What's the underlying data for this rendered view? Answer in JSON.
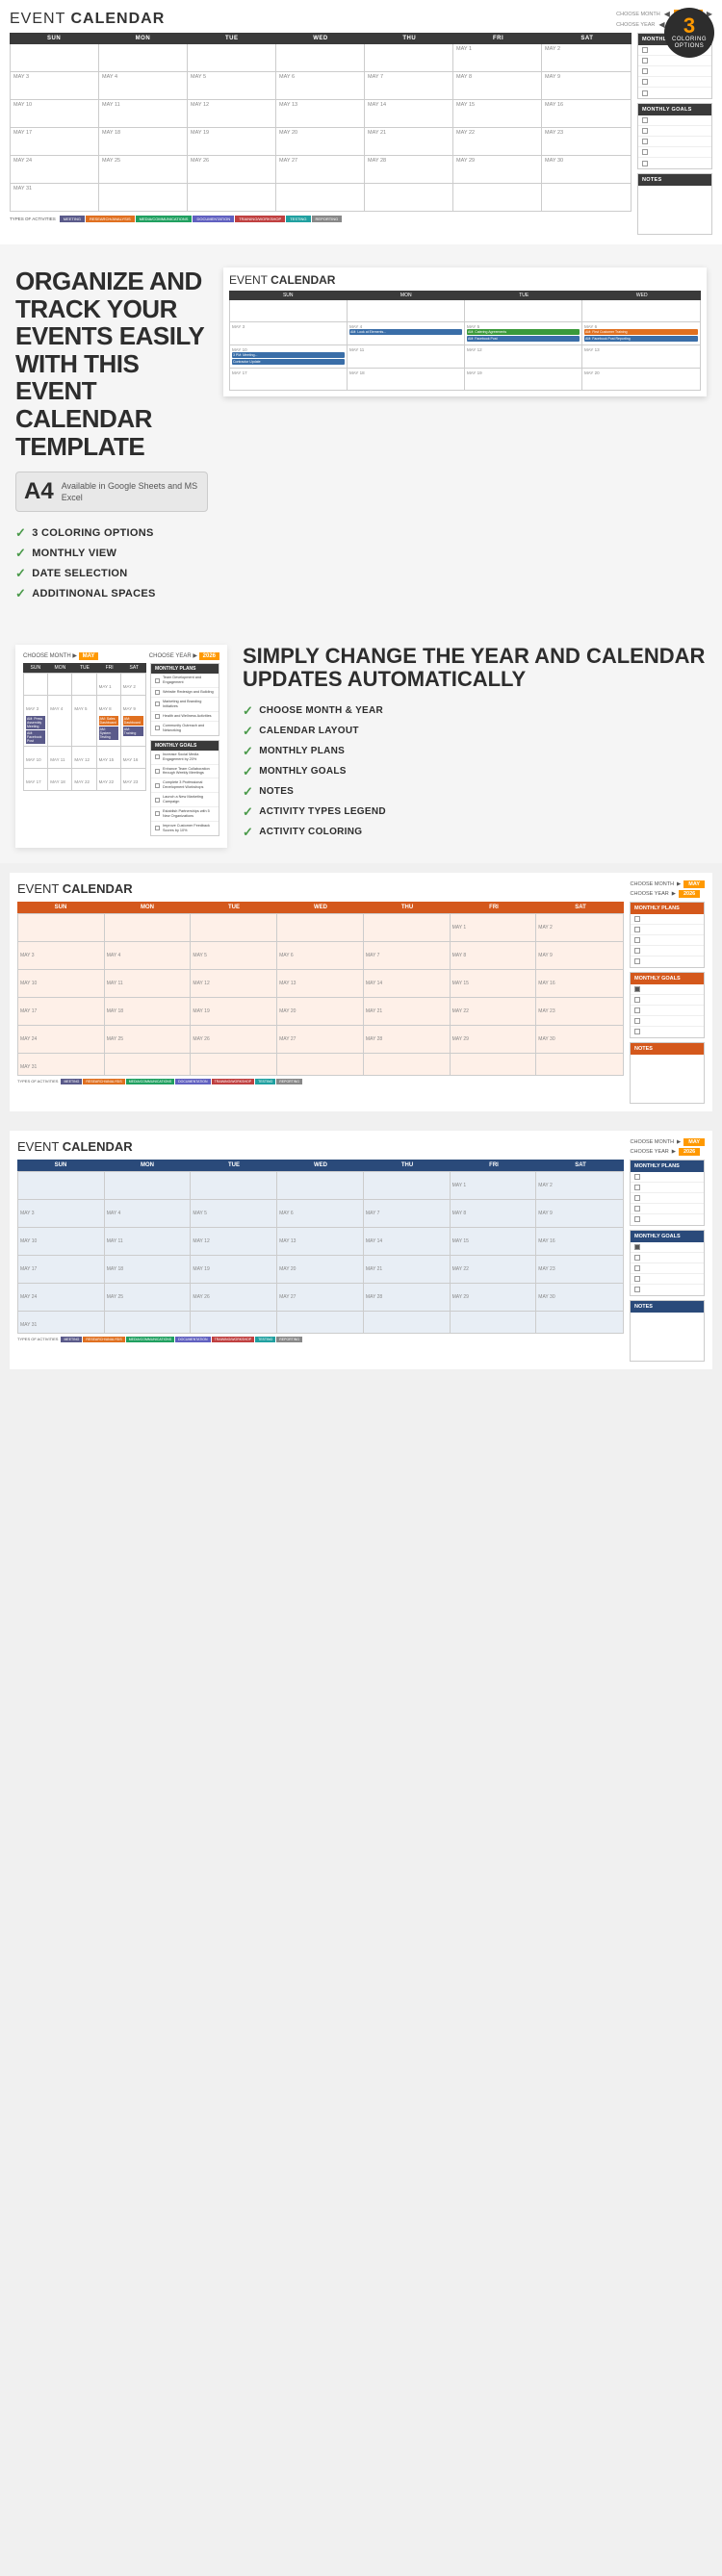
{
  "badge": {
    "number": "3",
    "line1": "COLORING",
    "line2": "OPTIONS"
  },
  "calendar1": {
    "title": "EVENT",
    "title_bold": "CALENDAR",
    "choose_month_label": "CHOOSE MONTH",
    "choose_year_label": "CHOOSE YEAR",
    "month_val": "MAY",
    "year_val": "2026",
    "days": [
      "SUN",
      "MON",
      "TUE",
      "WED",
      "THU",
      "FRI",
      "SAT"
    ],
    "sidebar_plans_title": "MONTHLY PLANS",
    "sidebar_goals_title": "MONTHLY GOALS",
    "sidebar_notes_title": "NOTES",
    "activity_types_title": "TYPES OF ACTIVITIES",
    "activity_types": [
      {
        "label": "MEETING",
        "color": "#5a5a8a"
      },
      {
        "label": "RESEARCH/ANALYSIS",
        "color": "#e07020"
      },
      {
        "label": "MEDIA/COMMUNICATIONS",
        "color": "#20a060"
      },
      {
        "label": "DOCUMENTATION",
        "color": "#6060c0"
      },
      {
        "label": "TRAINING/WORKSHOP",
        "color": "#c04040"
      },
      {
        "label": "TESTING",
        "color": "#20a0a0"
      },
      {
        "label": "REPORTING",
        "color": "#888888"
      }
    ]
  },
  "features": {
    "title": "ORGANIZE AND TRACK YOUR EVENTS EASILY WITH THIS EVENT CALENDAR TEMPLATE",
    "a4_letter": "A4",
    "a4_text": "Available in Google Sheets\nand MS Excel",
    "items": [
      "3 COLORING OPTIONS",
      "MONTHLY VIEW",
      "DATE SELECTION",
      "ADDITINONAL SPACES"
    ]
  },
  "plans_section": {
    "title": "SIMPLY CHANGE THE YEAR AND CALENDAR UPDATES AUTOMATICALLY",
    "items": [
      "CHOOSE MONTH & YEAR",
      "CALENDAR LAYOUT",
      "MONTHLY PLANS",
      "MONTHLY GOALS",
      "NOTES",
      "ACTIVITY TYPES LEGEND",
      "ACTIVITY COLORING"
    ],
    "monthly_plans_title": "MONTHLY PLANS",
    "monthly_goals_title": "MONTHLY GOALS",
    "plans_items": [
      "Team Development and Engagement",
      "Website Redesign and Building",
      "Marketing and Branding Initiatives",
      "Health and Wellness Activities",
      "Community Outreach and Networking"
    ],
    "goals_items": [
      "Increase Social Media Engagement by 20%",
      "Enhance Team Collaboration through Weekly Meetings",
      "Complete 3 Professional Development Workshops",
      "Launch a New Marketing Campaign",
      "Establish Partnerships with 5 New Organizations",
      "Improve Customer Feedback Scores by 10%"
    ]
  },
  "cal_labels": {
    "layout_label": "CALENDAR LAYOUT",
    "legend_label": "ACTIVITY TYPES LEGEND"
  },
  "colors": {
    "dark_header": "#3a3a3a",
    "orange_header": "#d4581c",
    "blue_header": "#2a4a7a",
    "accent_orange": "#e8601e",
    "accent_blue": "#1a3a6a"
  }
}
